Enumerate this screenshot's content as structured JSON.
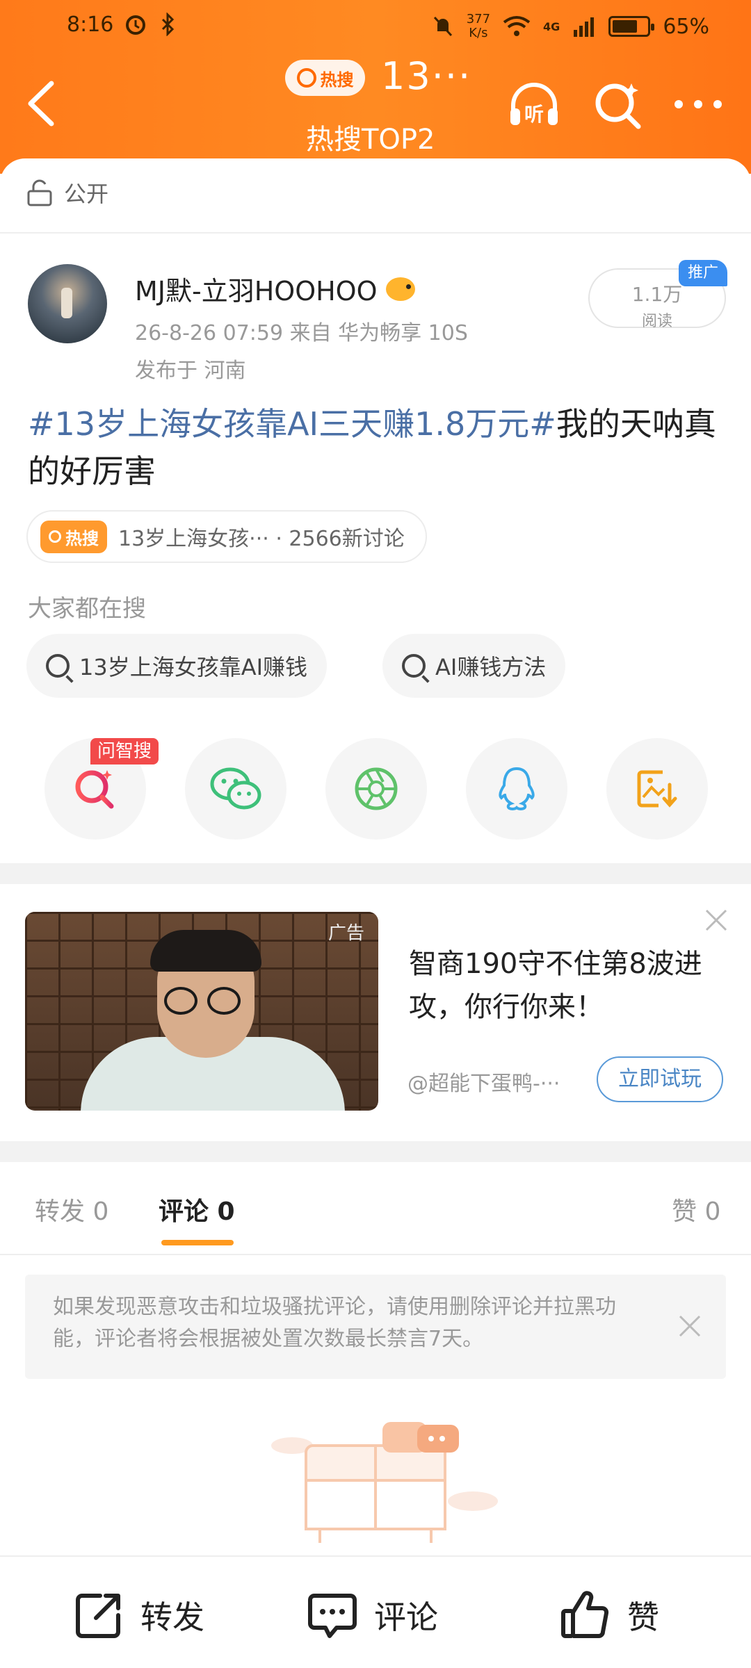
{
  "status_bar": {
    "time": "8:16",
    "net_speed_value": "377",
    "net_speed_unit": "K/s",
    "network": "4G",
    "battery": "65%",
    "battery_level": 0.65
  },
  "header": {
    "hot_label": "热搜",
    "title": "13···",
    "subtitle": "热搜TOP2",
    "listen_label": "听"
  },
  "visibility": {
    "label": "公开"
  },
  "post": {
    "author": "MJ默-立羽HOOHOO",
    "time_source": "26-8-26 07:59  来自 华为畅享 10S",
    "location": "发布于 河南",
    "reads": "1.1万",
    "reads_label": "阅读",
    "promo_badge": "推广",
    "hashtag": "#13岁上海女孩靠AI三天赚1.8万元#",
    "text": "我的天呐真的好厉害"
  },
  "hot_chip": {
    "tag": "热搜",
    "text": "13岁上海女孩··· · 2566新讨论"
  },
  "everyone_searching": {
    "label": "大家都在搜",
    "queries": [
      "13岁上海女孩靠AI赚钱",
      "AI赚钱方法"
    ]
  },
  "share": {
    "wenzhisou_badge": "问智搜",
    "icons": [
      "wenzhisou-search-icon",
      "wechat-icon",
      "moments-icon",
      "qq-icon",
      "save-image-icon"
    ]
  },
  "ad": {
    "label": "广告",
    "title": "智商190守不住第8波进攻，你行你来！",
    "author": "@超能下蛋鸭-···",
    "cta": "立即试玩"
  },
  "tabs": {
    "repost": "转发 0",
    "comment": "评论 0",
    "like": "赞 0"
  },
  "notice": {
    "text": "如果发现恶意攻击和垃圾骚扰评论，请使用删除评论并拉黑功能，评论者将会根据被处置次数最长禁言7天。"
  },
  "bottom_bar": {
    "repost": "转发",
    "comment": "评论",
    "like": "赞"
  },
  "colors": {
    "header_orange": "#ff7a1a",
    "hashtag_blue": "#4a6fa5",
    "tab_underline": "#ff9a1f",
    "badge_red": "#f24a4a",
    "promo_blue": "#3b8ef0"
  }
}
